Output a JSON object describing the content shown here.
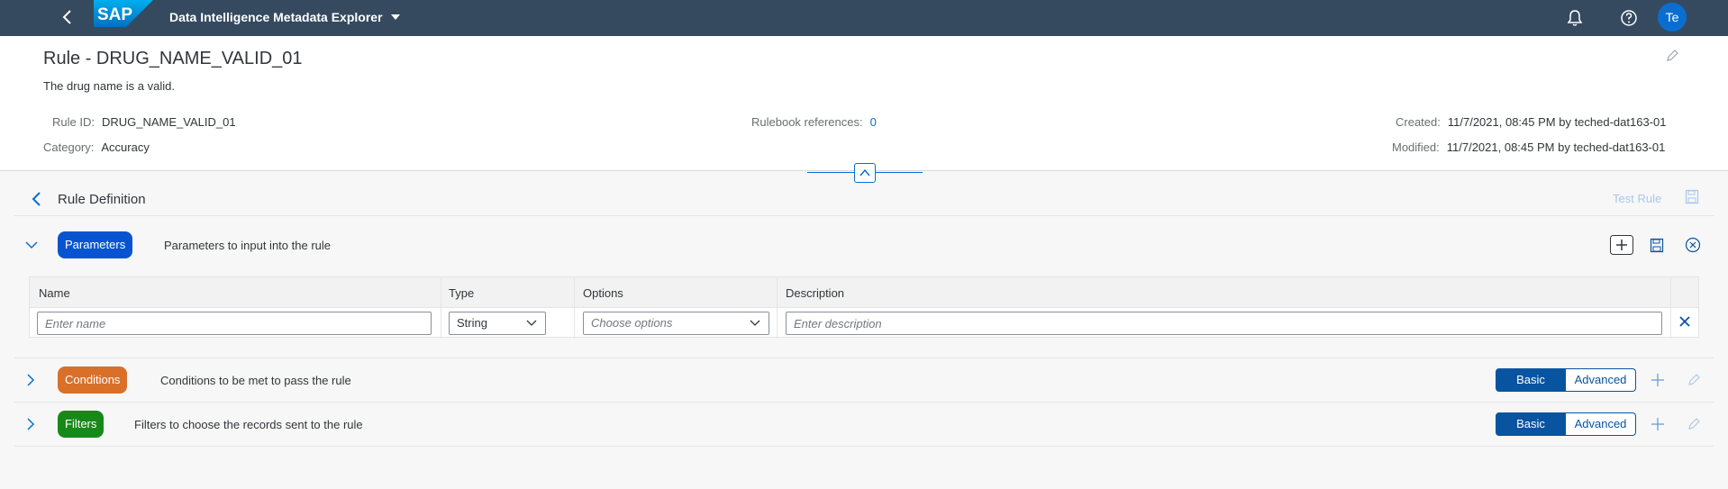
{
  "shell": {
    "logo_text": "SAP",
    "app_title": "Data Intelligence Metadata Explorer",
    "avatar": "Te",
    "icons": [
      "back-icon",
      "caret-down-icon",
      "bell-icon",
      "help-icon"
    ]
  },
  "header": {
    "title": "Rule - DRUG_NAME_VALID_01",
    "subtitle": "The drug name is a valid.",
    "rule_id_label": "Rule ID:",
    "rule_id": "DRUG_NAME_VALID_01",
    "category_label": "Category:",
    "category": "Accuracy",
    "rulebook_label": "Rulebook references:",
    "rulebook_count": "0",
    "created_label": "Created:",
    "created": "11/7/2021, 08:45 PM by teched-dat163-01",
    "modified_label": "Modified:",
    "modified": "11/7/2021, 08:45 PM by teched-dat163-01"
  },
  "definition": {
    "label": "Rule Definition",
    "test_rule": "Test Rule"
  },
  "parameters": {
    "pill": "Parameters",
    "desc": "Parameters to input into the rule",
    "columns": [
      "Name",
      "Type",
      "Options",
      "Description"
    ],
    "row": {
      "name_placeholder": "Enter name",
      "type_value": "String",
      "options_placeholder": "Choose options",
      "description_placeholder": "Enter description"
    }
  },
  "conditions": {
    "pill": "Conditions",
    "desc": "Conditions to be met to pass the rule",
    "basic": "Basic",
    "advanced": "Advanced"
  },
  "filters": {
    "pill": "Filters",
    "desc": "Filters to choose the records sent to the rule",
    "basic": "Basic",
    "advanced": "Advanced"
  },
  "colors": {
    "shell": "#354a5f",
    "accent": "#0a6ed1",
    "parameters_pill": "#0854d0",
    "conditions_pill": "#d9702a",
    "filters_pill": "#188918"
  }
}
